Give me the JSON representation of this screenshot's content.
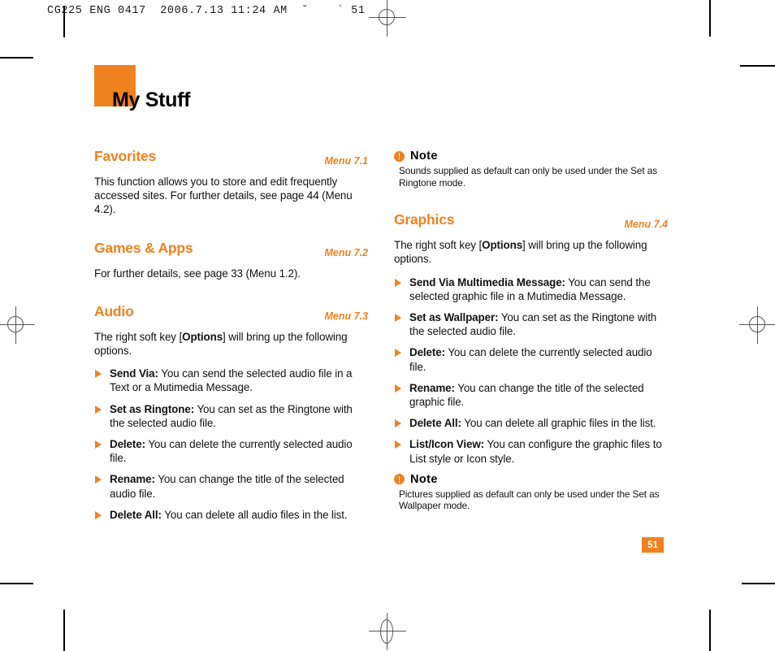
{
  "print_slug": "CG225 ENG 0417  2006.7.13 11:24 AM  ˘    ` 51",
  "page_title": "My Stuff",
  "page_number": "51",
  "accent_color": "#F0811F",
  "left_column": {
    "sections": [
      {
        "title": "Favorites",
        "menu": "Menu 7.1",
        "paragraph": "This function allows you to store and edit frequently accessed sites. For further details, see page 44 (Menu 4.2)."
      },
      {
        "title": "Games & Apps",
        "menu": "Menu 7.2",
        "paragraph": "For further details, see page 33 (Menu 1.2)."
      },
      {
        "title": "Audio",
        "menu": "Menu 7.3",
        "intro_pre": "The right soft key [",
        "intro_bold": "Options",
        "intro_post": "] will bring up the following options.",
        "options": [
          {
            "label": "Send Via:",
            "text": " You can send the selected audio file in a Text or a Mutimedia Message."
          },
          {
            "label": "Set as Ringtone:",
            "text": " You can set as the Ringtone with the selected audio file."
          },
          {
            "label": "Delete:",
            "text": " You can delete the currently selected audio file."
          },
          {
            "label": "Rename:",
            "text": " You can change the title of the selected audio file."
          },
          {
            "label": "Delete All:",
            "text": " You can delete all audio files in the list."
          }
        ]
      }
    ]
  },
  "right_column": {
    "note_top": {
      "icon": "note-exclamation-icon",
      "title": "Note",
      "body": "Sounds supplied as default can only be used under the Set as Ringtone mode."
    },
    "section": {
      "title": "Graphics",
      "menu": "Menu 7.4",
      "intro_pre": "The right soft key [",
      "intro_bold": "Options",
      "intro_post": "] will bring up the following options.",
      "options": [
        {
          "label": "Send Via Multimedia Message:",
          "text": " You can send the selected graphic file in a Mutimedia Message."
        },
        {
          "label": "Set as Wallpaper:",
          "text": " You can set as the Ringtone with the selected audio file."
        },
        {
          "label": "Delete:",
          "text": " You can delete the currently selected audio file."
        },
        {
          "label": "Rename:",
          "text": " You can change the title of the selected graphic file."
        },
        {
          "label": "Delete All:",
          "text": " You can delete all graphic files in the list."
        },
        {
          "label": "List/Icon View:",
          "text": " You can configure the graphic files to List style or Icon  style."
        }
      ]
    },
    "note_bottom": {
      "icon": "note-exclamation-icon",
      "title": "Note",
      "body": "Pictures supplied as default can only be used under the Set as Wallpaper mode."
    }
  }
}
